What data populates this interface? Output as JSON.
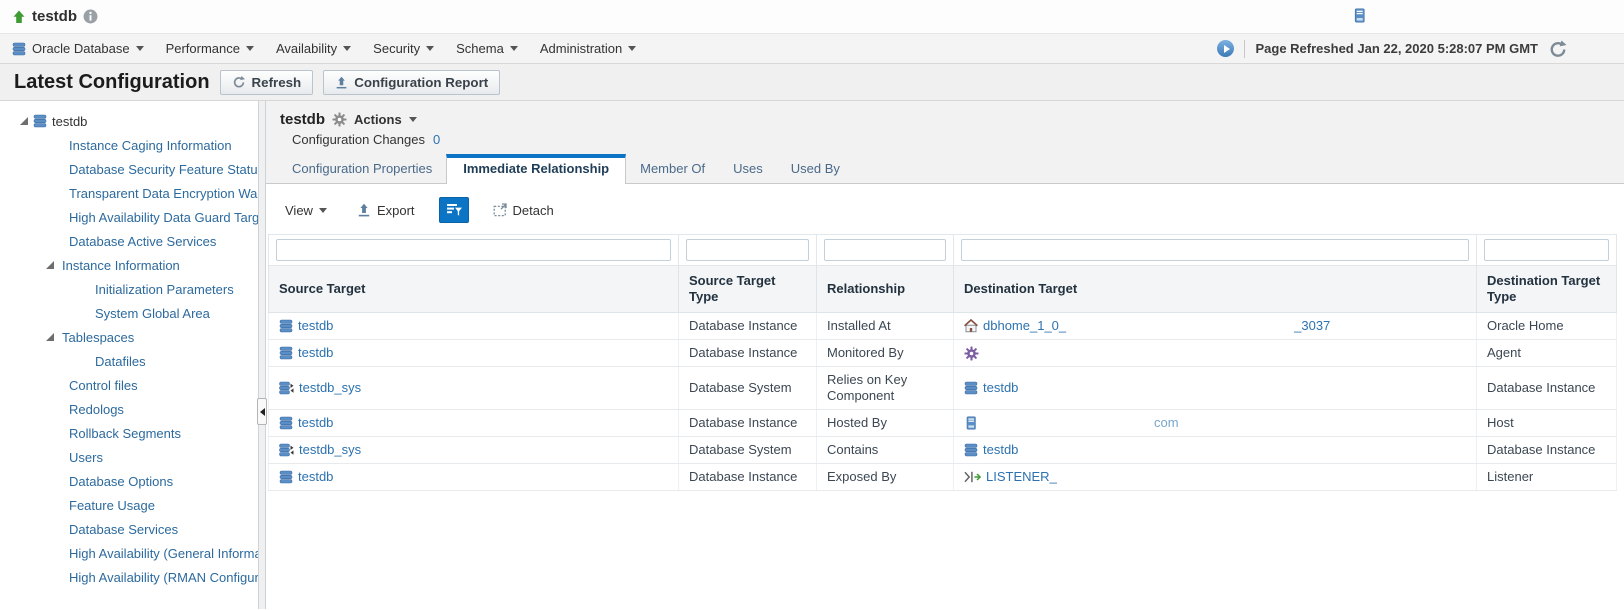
{
  "colors": {
    "accent_blue": "#0b74c4",
    "link_blue": "#2d72b0",
    "status_green": "#3f9c35",
    "agent_purple": "#7d5fa0"
  },
  "topbar": {
    "title": "testdb"
  },
  "menubar": {
    "items": [
      "Oracle Database",
      "Performance",
      "Availability",
      "Security",
      "Schema",
      "Administration"
    ],
    "page_refreshed": "Page Refreshed Jan 22, 2020 5:28:07 PM GMT"
  },
  "header": {
    "title": "Latest Configuration",
    "refresh_label": "Refresh",
    "report_label": "Configuration Report"
  },
  "tree": {
    "items": [
      {
        "label": "testdb"
      },
      {
        "label": "Instance Caging Information"
      },
      {
        "label": "Database Security Feature Status"
      },
      {
        "label": "Transparent Data Encryption Wallet"
      },
      {
        "label": "High Availability Data Guard Target S"
      },
      {
        "label": "Database Active Services"
      },
      {
        "label": "Instance Information"
      },
      {
        "label": "Initialization Parameters"
      },
      {
        "label": "System Global Area"
      },
      {
        "label": "Tablespaces"
      },
      {
        "label": "Datafiles"
      },
      {
        "label": "Control files"
      },
      {
        "label": "Redologs"
      },
      {
        "label": "Rollback Segments"
      },
      {
        "label": "Users"
      },
      {
        "label": "Database Options"
      },
      {
        "label": "Feature Usage"
      },
      {
        "label": "Database Services"
      },
      {
        "label": "High Availability (General Information"
      },
      {
        "label": "High Availability (RMAN Configuration"
      }
    ]
  },
  "main": {
    "title": "testdb",
    "actions": "Actions",
    "config_changes": {
      "label": "Configuration Changes",
      "count": "0"
    },
    "tabs": [
      "Configuration Properties",
      "Immediate Relationship",
      "Member Of",
      "Uses",
      "Used By"
    ],
    "active_tab": "Immediate Relationship",
    "toolbar": {
      "view": "View",
      "export": "Export",
      "detach": "Detach"
    },
    "table": {
      "columns": [
        "Source Target",
        "Source Target Type",
        "Relationship",
        "Destination Target",
        "Destination Target Type"
      ],
      "rows": [
        {
          "source": "testdb",
          "source_type": "Database Instance",
          "relationship": "Installed At",
          "dest_prefix": "dbhome_1_0_",
          "dest_redacted": true,
          "dest_suffix": "_3037",
          "dest_icon": "oracle-home",
          "dest_type": "Oracle Home"
        },
        {
          "source": "testdb",
          "source_type": "Database Instance",
          "relationship": "Monitored By",
          "dest_prefix": "",
          "dest_redacted": true,
          "dest_suffix": "",
          "dest_icon": "agent",
          "dest_type": "Agent"
        },
        {
          "source": "testdb_sys",
          "source_type": "Database System",
          "relationship": "Relies on Key Component",
          "dest_prefix": "testdb",
          "dest_redacted": false,
          "dest_suffix": "",
          "dest_icon": "database-instance",
          "dest_type": "Database Instance"
        },
        {
          "source": "testdb",
          "source_type": "Database Instance",
          "relationship": "Hosted By",
          "dest_prefix": "",
          "dest_redacted": true,
          "dest_suffix": "com",
          "dest_icon": "host",
          "dest_type": "Host"
        },
        {
          "source": "testdb_sys",
          "source_type": "Database System",
          "relationship": "Contains",
          "dest_prefix": "testdb",
          "dest_redacted": false,
          "dest_suffix": "",
          "dest_icon": "database-instance",
          "dest_type": "Database Instance"
        },
        {
          "source": "testdb",
          "source_type": "Database Instance",
          "relationship": "Exposed By",
          "dest_prefix": "LISTENER_",
          "dest_redacted": true,
          "dest_suffix": "",
          "dest_icon": "listener",
          "dest_type": "Listener"
        }
      ]
    }
  }
}
